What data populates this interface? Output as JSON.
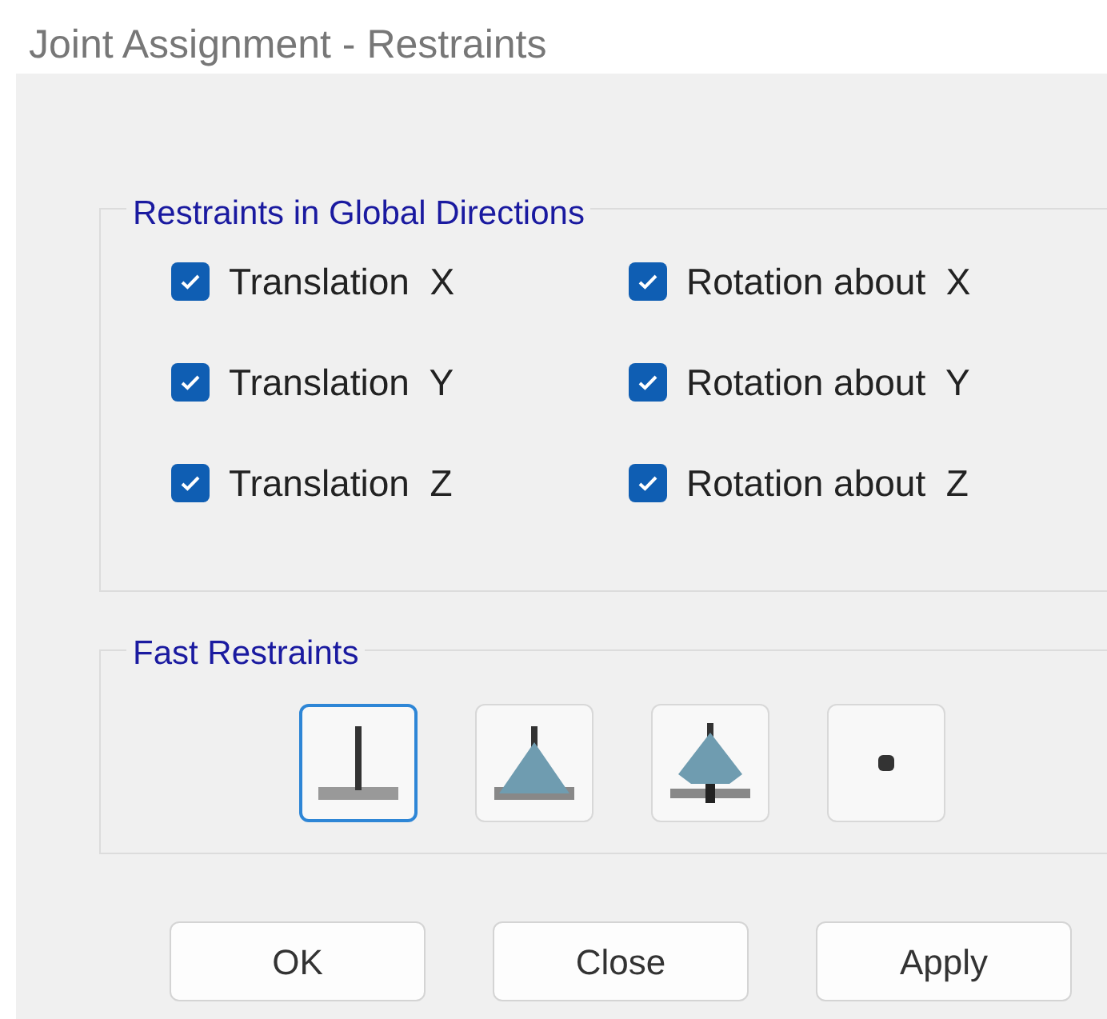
{
  "window": {
    "title": "Joint Assignment - Restraints"
  },
  "restraints_group": {
    "title": "Restraints in Global Directions",
    "checkboxes": [
      {
        "label": "Translation  X",
        "checked": true
      },
      {
        "label": "Rotation about  X",
        "checked": true
      },
      {
        "label": "Translation  Y",
        "checked": true
      },
      {
        "label": "Rotation about  Y",
        "checked": true
      },
      {
        "label": "Translation  Z",
        "checked": true
      },
      {
        "label": "Rotation about  Z",
        "checked": true
      }
    ]
  },
  "fast_restraints": {
    "title": "Fast Restraints",
    "buttons": [
      {
        "kind": "fixed",
        "selected": true
      },
      {
        "kind": "pinned",
        "selected": false
      },
      {
        "kind": "roller",
        "selected": false
      },
      {
        "kind": "free",
        "selected": false
      }
    ]
  },
  "buttons": [
    "OK",
    "Close",
    "Apply"
  ]
}
